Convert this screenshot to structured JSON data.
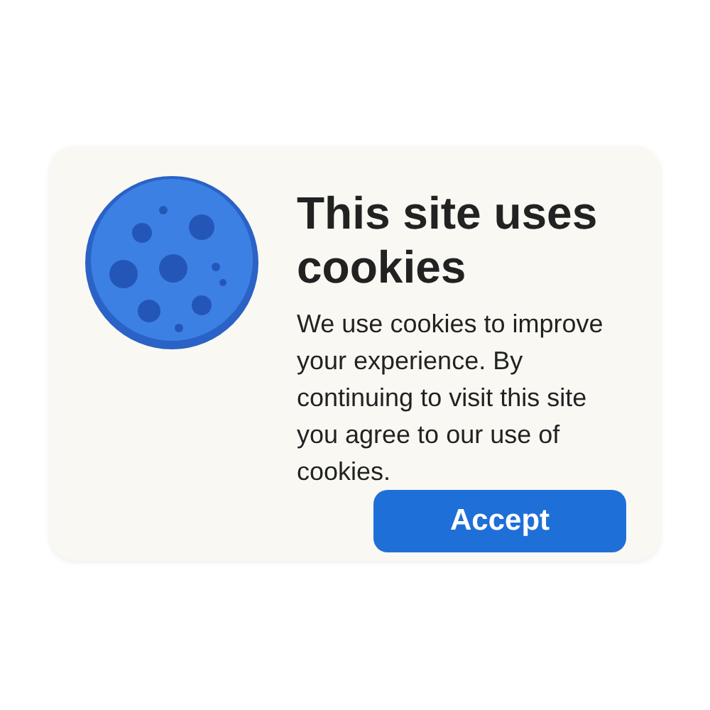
{
  "dialog": {
    "title": "This site uses cookies",
    "message": "We use cookies to improve your experience. By continuing to visit this site you agree to our use of cookies.",
    "buttons": [
      {
        "label": "Accept",
        "kind": "primary"
      }
    ]
  }
}
